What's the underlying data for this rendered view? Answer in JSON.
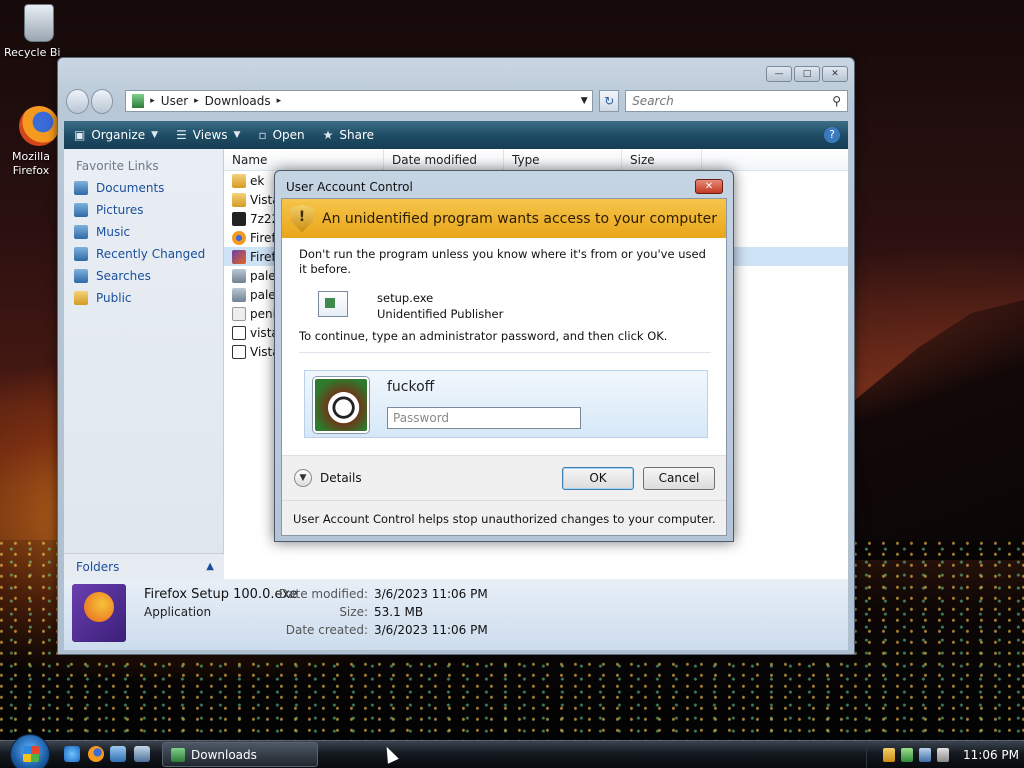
{
  "desktop": {
    "icons": [
      {
        "label": "Recycle Bin",
        "icon": "recycle-bin-icon"
      },
      {
        "label": "Mozilla Firefox",
        "icon": "firefox-icon"
      }
    ]
  },
  "explorer": {
    "title": "Downloads",
    "breadcrumb": [
      "User",
      "Downloads"
    ],
    "search_placeholder": "Search",
    "toolbar": {
      "organize": "Organize",
      "views": "Views",
      "open": "Open",
      "share": "Share",
      "help": "?"
    },
    "nav": {
      "favorite_links_title": "Favorite Links",
      "items": [
        {
          "label": "Documents"
        },
        {
          "label": "Pictures"
        },
        {
          "label": "Music"
        },
        {
          "label": "Recently Changed"
        },
        {
          "label": "Searches"
        },
        {
          "label": "Public"
        }
      ],
      "folders_label": "Folders"
    },
    "columns": [
      "Name",
      "Date modified",
      "Type",
      "Size"
    ],
    "files": [
      {
        "name": "ek",
        "icon": "folder-icon"
      },
      {
        "name": "Vista",
        "icon": "folder-icon"
      },
      {
        "name": "7z22",
        "icon": "7zip-icon"
      },
      {
        "name": "Firef",
        "icon": "firefox-icon"
      },
      {
        "name": "Firef",
        "icon": "firefox-setup-icon"
      },
      {
        "name": "pale",
        "icon": "installer-icon"
      },
      {
        "name": "pale",
        "icon": "installer-icon"
      },
      {
        "name": "peni",
        "icon": "file-icon"
      },
      {
        "name": "vista",
        "icon": "setup-icon"
      },
      {
        "name": "Vista",
        "icon": "setup-icon"
      }
    ],
    "details": {
      "filename": "Firefox Setup 100.0.exe",
      "type": "Application",
      "date_modified_label": "Date modified:",
      "date_modified": "3/6/2023 11:06 PM",
      "size_label": "Size:",
      "size": "53.1 MB",
      "date_created_label": "Date created:",
      "date_created": "3/6/2023 11:06 PM"
    }
  },
  "uac": {
    "title": "User Account Control",
    "banner": "An unidentified program wants access to your computer",
    "warning": "Don't run the program unless you know where it's from or you've used it before.",
    "program_name": "setup.exe",
    "publisher": "Unidentified Publisher",
    "continue_text": "To continue, type an administrator password, and then click OK.",
    "username": "fuckoff",
    "password_placeholder": "Password",
    "details_label": "Details",
    "ok_label": "OK",
    "cancel_label": "Cancel",
    "footer_note": "User Account Control helps stop unauthorized changes to your computer."
  },
  "taskbar": {
    "task_label": "Downloads",
    "clock": "11:06 PM"
  }
}
